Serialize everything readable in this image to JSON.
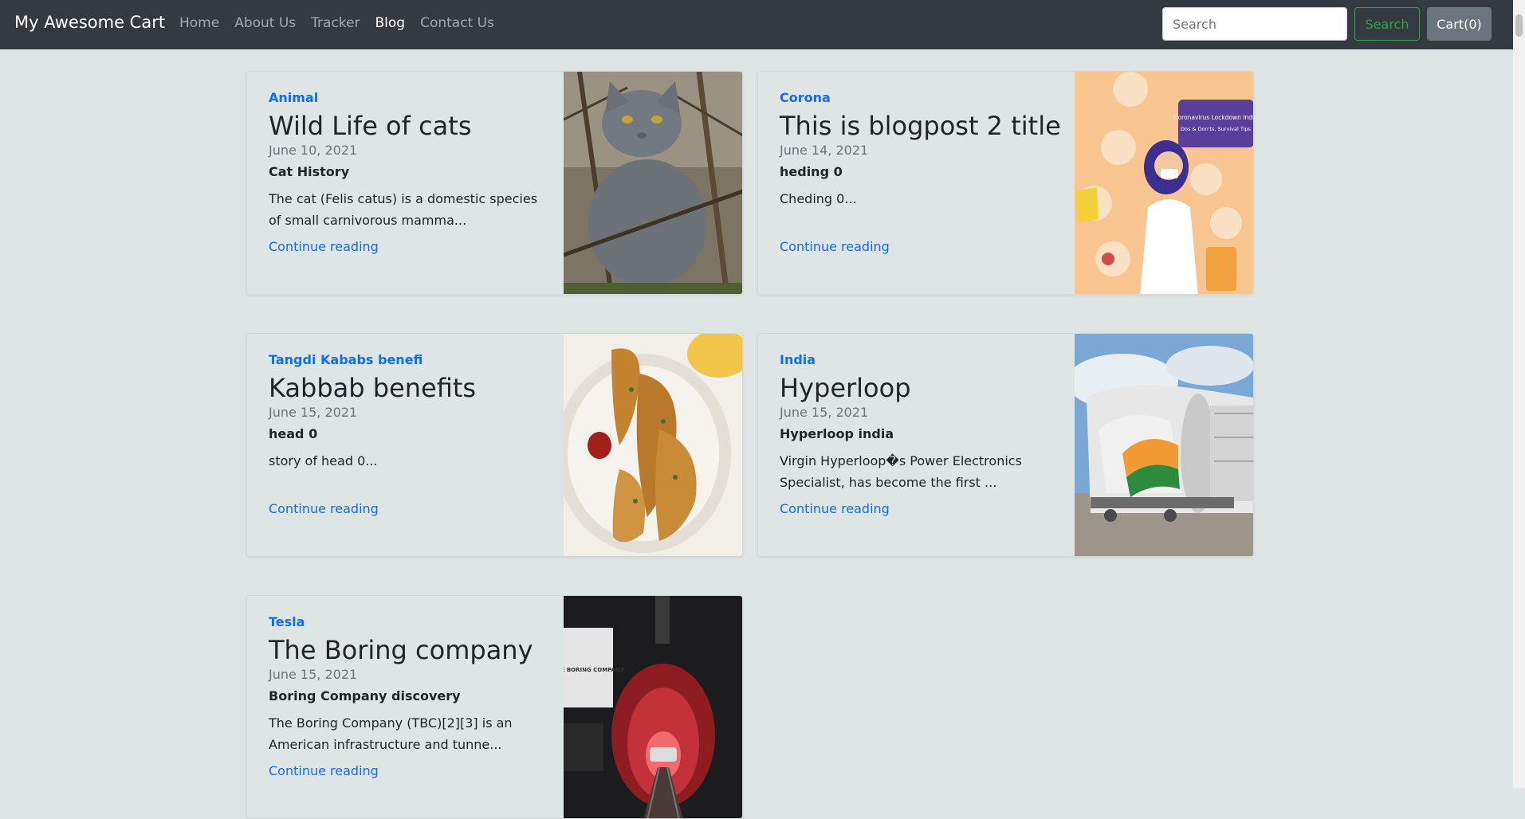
{
  "navbar": {
    "brand": "My Awesome Cart",
    "links": [
      "Home",
      "About Us",
      "Tracker",
      "Blog",
      "Contact Us"
    ],
    "active_link": "Blog",
    "search_placeholder": "Search",
    "search_button": "Search",
    "cart_button": "Cart(0)"
  },
  "posts": [
    {
      "category": "Animal",
      "title": "Wild Life of cats",
      "date": "June 10, 2021",
      "heading": "Cat History",
      "excerpt": "The cat (Felis catus) is a domestic species of small carnivorous mamma...",
      "link": "Continue reading",
      "image": "cat-photo"
    },
    {
      "category": "Corona",
      "title": "This is blogpost 2 title",
      "date": "June 14, 2021",
      "heading": "heding 0",
      "excerpt": "Cheding 0...",
      "link": "Continue reading",
      "image": "coronavirus-lockdown-illustration"
    },
    {
      "category": "Tangdi Kababs benefi",
      "title": "Kabbab benefits",
      "date": "June 15, 2021",
      "heading": "head 0",
      "excerpt": "story of head 0...",
      "link": "Continue reading",
      "image": "fried-chicken-photo"
    },
    {
      "category": "India",
      "title": "Hyperloop",
      "date": "June 15, 2021",
      "heading": "Hyperloop india",
      "excerpt": "Virgin Hyperloop�s Power Electronics Specialist, has become the first ...",
      "link": "Continue reading",
      "image": "hyperloop-pod-photo"
    },
    {
      "category": "Tesla",
      "title": "The Boring company",
      "date": "June 15, 2021",
      "heading": "Boring Company discovery",
      "excerpt": "The Boring Company (TBC)[2][3] is an American infrastructure and tunne...",
      "link": "Continue reading",
      "image": "boring-company-tunnel-photo"
    }
  ],
  "image_text": {
    "corona_banner": "Coronavirus Lockdown India",
    "corona_banner_sub": "Dos & Don'ts, Survival Tips",
    "boring_sign": "THE BORING COMPANY"
  },
  "colors": {
    "navbar_bg": "#343a40",
    "page_bg": "#dfe4e4",
    "link": "#0d6efd",
    "search_button": "#28a745",
    "cart_button": "#6c757d"
  }
}
